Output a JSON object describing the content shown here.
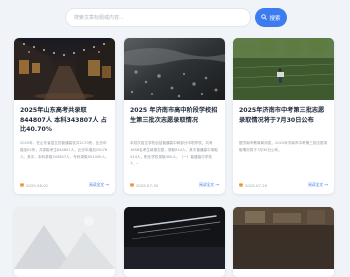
{
  "search": {
    "placeholder": "搜索文章标题或内容...",
    "button_label": "搜索"
  },
  "articles": [
    {
      "title": "2025年山东高考共录取844807人 本科343807人 占比40.70%",
      "excerpt": "2025年，在山东省招生的普通高校共2170所，比去年增加62所；共录取考生844807人，比去年增加20076人。其中，本科录取343807人，专科录取501000人。",
      "date": "2025-08-02",
      "read_more": "阅读全文"
    },
    {
      "title": "2025 年济南市高中阶段学校招生第三批次志愿录取情况",
      "excerpt": "本批次招生学校包括普通高中和部分中职学校，共有1658名考生填报志愿，录取814人，其中普通高中录取414人，职业学校录取400人。（一）普通高中学校  1、...",
      "date": "2025-07-30",
      "read_more": "阅读全文"
    },
    {
      "title": "2025年济南市中考第三批志愿录取情况将于7月30日公布",
      "excerpt": "据济南市教育局消息，2025年济南市中考第三批志愿录取情况将于7月30日公布。",
      "date": "2025-07-29",
      "read_more": "阅读全文"
    }
  ]
}
